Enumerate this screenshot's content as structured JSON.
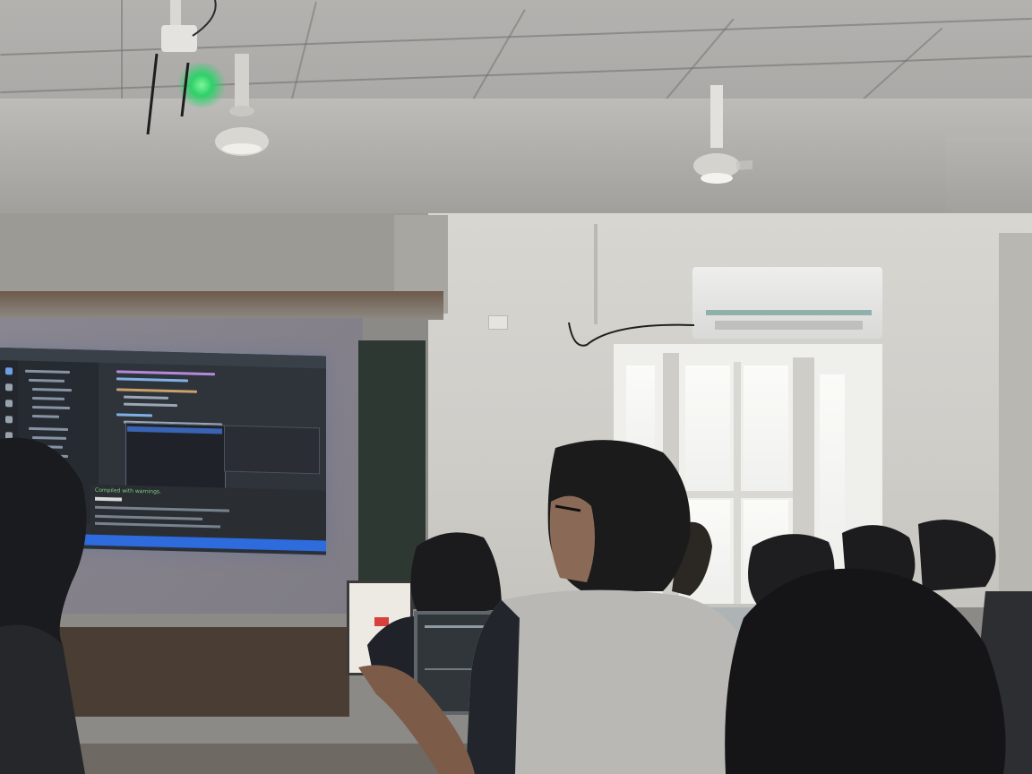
{
  "scene": "classroom",
  "colors": {
    "ceiling": "#aeada9",
    "wall": "#d4d2cd",
    "screen_bg": "#2b3038",
    "statusbar": "#2e6bdc",
    "indicator_glow": "#2fd16a"
  },
  "projected_screen": {
    "terminal_heading": "Compiled with warnings."
  },
  "icons": [
    "ceiling-fan-icon",
    "air-conditioner-icon",
    "power-socket-icon",
    "camera-indicator-icon"
  ]
}
